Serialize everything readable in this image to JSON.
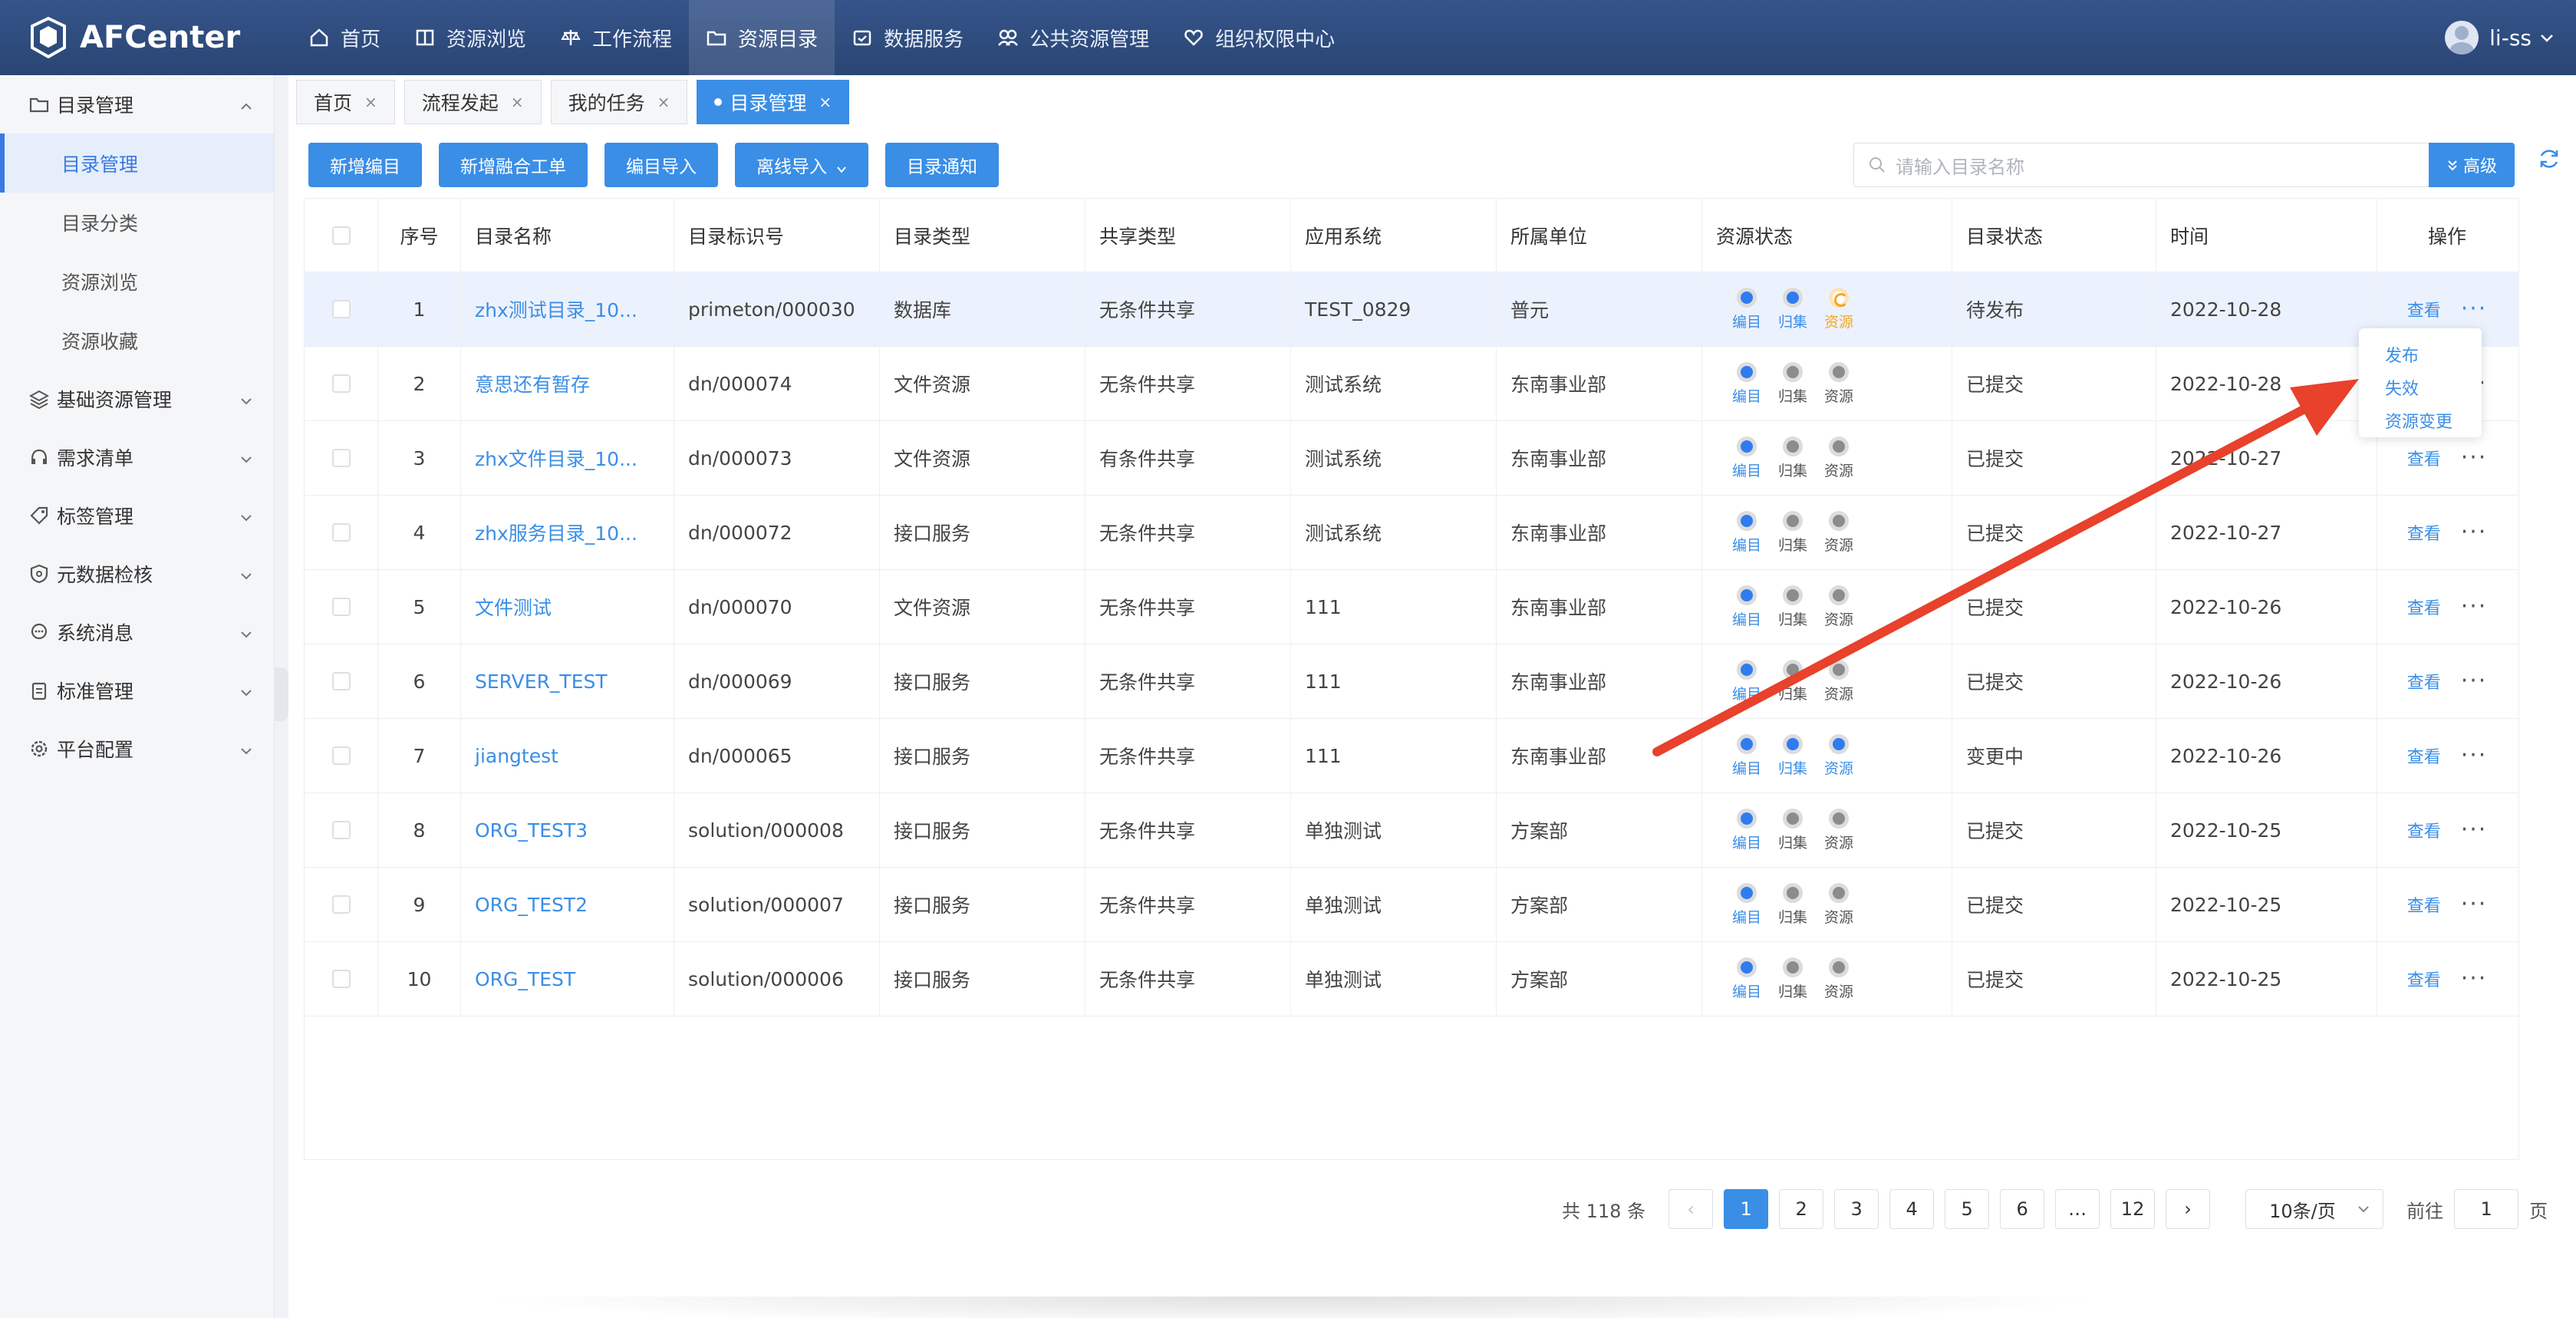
{
  "app": {
    "name": "AFCenter"
  },
  "topnav": [
    {
      "label": "首页",
      "icon": "home-icon"
    },
    {
      "label": "资源浏览",
      "icon": "book-icon"
    },
    {
      "label": "工作流程",
      "icon": "scale-icon"
    },
    {
      "label": "资源目录",
      "icon": "folder-icon",
      "active": true
    },
    {
      "label": "数据服务",
      "icon": "calendar-icon"
    },
    {
      "label": "公共资源管理",
      "icon": "users-icon"
    },
    {
      "label": "组织权限中心",
      "icon": "heart-icon"
    }
  ],
  "user": {
    "name": "li-ss"
  },
  "sidebar": {
    "group0": "目录管理",
    "subs": [
      "目录管理",
      "目录分类",
      "资源浏览",
      "资源收藏"
    ],
    "groups": [
      "基础资源管理",
      "需求清单",
      "标签管理",
      "元数据检核",
      "系统消息",
      "标准管理",
      "平台配置"
    ]
  },
  "tabs": [
    {
      "label": "首页",
      "close": "×"
    },
    {
      "label": "流程发起",
      "close": "×"
    },
    {
      "label": "我的任务",
      "close": "×"
    },
    {
      "label": "目录管理",
      "close": "×",
      "active": true
    }
  ],
  "toolbar": {
    "buttons": [
      "新增编目",
      "新增融合工单",
      "编目导入",
      "离线导入",
      "目录通知"
    ],
    "search_placeholder": "请输入目录名称",
    "advanced": "高级"
  },
  "table": {
    "headers": [
      "序号",
      "目录名称",
      "目录标识号",
      "目录类型",
      "共享类型",
      "应用系统",
      "所属单位",
      "资源状态",
      "目录状态",
      "时间",
      "操作"
    ],
    "res_labels": [
      "编目",
      "归集",
      "资源"
    ],
    "view_label": "查看",
    "more_label": "···",
    "rows": [
      {
        "no": "1",
        "name": "zhx测试目录_10...",
        "id": "primeton/000030",
        "type": "数据库",
        "share": "无条件共享",
        "app": "TEST_0829",
        "unit": "普元",
        "res": [
          "blue",
          "blue",
          "orange"
        ],
        "status": "待发布",
        "time": "2022-10-28"
      },
      {
        "no": "2",
        "name": "意思还有暂存",
        "id": "dn/000074",
        "type": "文件资源",
        "share": "无条件共享",
        "app": "测试系统",
        "unit": "东南事业部",
        "res": [
          "blue",
          "gray",
          "gray"
        ],
        "status": "已提交",
        "time": "2022-10-28"
      },
      {
        "no": "3",
        "name": "zhx文件目录_10...",
        "id": "dn/000073",
        "type": "文件资源",
        "share": "有条件共享",
        "app": "测试系统",
        "unit": "东南事业部",
        "res": [
          "blue",
          "gray",
          "gray"
        ],
        "status": "已提交",
        "time": "2022-10-27"
      },
      {
        "no": "4",
        "name": "zhx服务目录_10...",
        "id": "dn/000072",
        "type": "接口服务",
        "share": "无条件共享",
        "app": "测试系统",
        "unit": "东南事业部",
        "res": [
          "blue",
          "gray",
          "gray"
        ],
        "status": "已提交",
        "time": "2022-10-27"
      },
      {
        "no": "5",
        "name": "文件测试",
        "id": "dn/000070",
        "type": "文件资源",
        "share": "无条件共享",
        "app": "111",
        "unit": "东南事业部",
        "res": [
          "blue",
          "gray",
          "gray"
        ],
        "status": "已提交",
        "time": "2022-10-26"
      },
      {
        "no": "6",
        "name": "SERVER_TEST",
        "id": "dn/000069",
        "type": "接口服务",
        "share": "无条件共享",
        "app": "111",
        "unit": "东南事业部",
        "res": [
          "blue",
          "gray",
          "gray"
        ],
        "status": "已提交",
        "time": "2022-10-26"
      },
      {
        "no": "7",
        "name": "jiangtest",
        "id": "dn/000065",
        "type": "接口服务",
        "share": "无条件共享",
        "app": "111",
        "unit": "东南事业部",
        "res": [
          "blue",
          "blue",
          "blue"
        ],
        "status": "变更中",
        "time": "2022-10-26"
      },
      {
        "no": "8",
        "name": "ORG_TEST3",
        "id": "solution/000008",
        "type": "接口服务",
        "share": "无条件共享",
        "app": "单独测试",
        "unit": "方案部",
        "res": [
          "blue",
          "gray",
          "gray"
        ],
        "status": "已提交",
        "time": "2022-10-25"
      },
      {
        "no": "9",
        "name": "ORG_TEST2",
        "id": "solution/000007",
        "type": "接口服务",
        "share": "无条件共享",
        "app": "单独测试",
        "unit": "方案部",
        "res": [
          "blue",
          "gray",
          "gray"
        ],
        "status": "已提交",
        "time": "2022-10-25"
      },
      {
        "no": "10",
        "name": "ORG_TEST",
        "id": "solution/000006",
        "type": "接口服务",
        "share": "无条件共享",
        "app": "单独测试",
        "unit": "方案部",
        "res": [
          "blue",
          "gray",
          "gray"
        ],
        "status": "已提交",
        "time": "2022-10-25"
      }
    ]
  },
  "dropdown": [
    "发布",
    "失效",
    "资源变更"
  ],
  "pager": {
    "total": "共 118 条",
    "prev": "‹",
    "pages": [
      "1",
      "2",
      "3",
      "4",
      "5",
      "6",
      "…",
      "12"
    ],
    "next": "›",
    "size": "10条/页",
    "goto": "前往",
    "goto_value": "1",
    "page_unit": "页"
  },
  "colors": {
    "header": "#2d4a7a",
    "accent": "#3a8ee6",
    "arrow": "#e8412c"
  }
}
